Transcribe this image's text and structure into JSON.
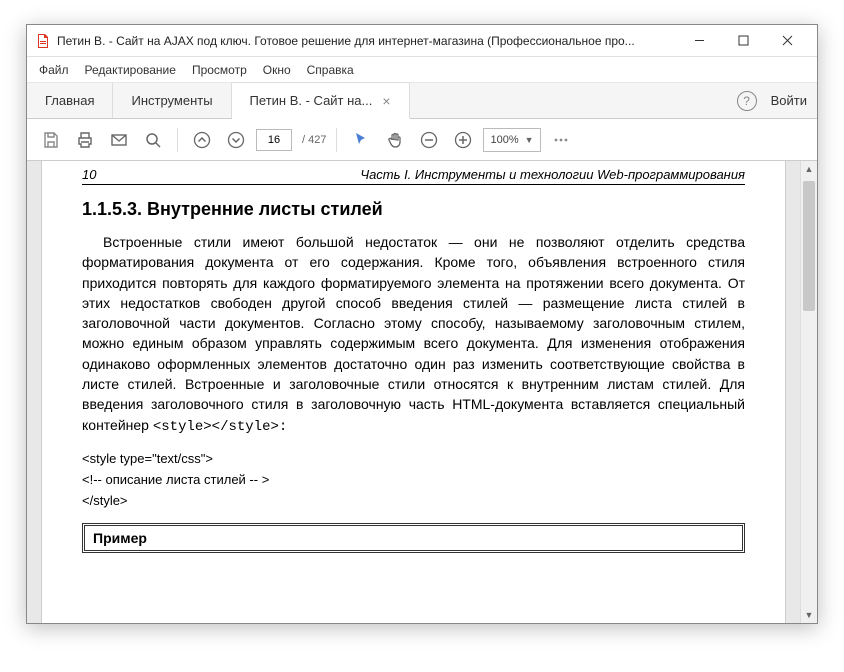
{
  "titlebar": {
    "title": "Петин В. - Сайт на AJAX под ключ. Готовое решение для интернет-магазина (Профессиональное про..."
  },
  "menubar": [
    "Файл",
    "Редактирование",
    "Просмотр",
    "Окно",
    "Справка"
  ],
  "tabs": {
    "home": "Главная",
    "tools": "Инструменты",
    "doc": "Петин В. - Сайт на..."
  },
  "signin": "Войти",
  "toolbar": {
    "page": "16",
    "total": "/ 427",
    "zoom": "100%"
  },
  "doc": {
    "pageno": "10",
    "part": "Часть I. Инструменты и технологии Web-программирования",
    "heading": "1.1.5.3. Внутренние листы стилей",
    "body": "Встроенные стили имеют большой недостаток — они не позволяют отделить средства форматирования документа от его содержания. Кроме того, объявления встроенного стиля приходится повторять для каждого форматируемого элемента на протяжении всего документа. От этих недостатков свободен другой способ введения стилей — размещение листа стилей в заголовочной части документов. Согласно этому способу, называемому заголовочным стилем, можно единым образом управлять содержимым всего документа. Для изменения отображения одинаково оформленных элементов достаточно один раз изменить соответствующие свойства в листе стилей. Встроенные и заголовочные стили относятся к внутренним листам стилей. Для введения заголовочного стиля в заголовочную часть HTML-документа вставляется специальный контейнер ",
    "inlinecode": "<style></style>:",
    "code1": "<style type=\"text/css\">",
    "code2": "<!--  описание листа стилей  -- >",
    "code3": "</style>",
    "example": "Пример"
  }
}
